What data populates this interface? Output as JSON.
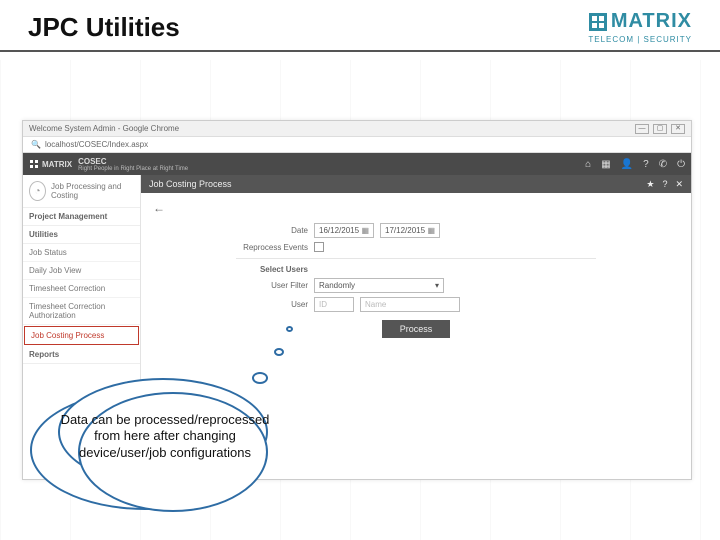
{
  "slide": {
    "title": "JPC Utilities"
  },
  "brand": {
    "name": "MATRIX",
    "sub": "TELECOM | SECURITY"
  },
  "browser": {
    "tab_title": "Welcome System Admin - Google Chrome",
    "url_prefix": "🔍",
    "url": "localhost/COSEC/Index.aspx"
  },
  "appbar": {
    "logo": "MATRIX",
    "product": "COSEC",
    "tagline": "Right People in Right Place at Right Time",
    "icons": {
      "home": "⌂",
      "apps": "▦",
      "user": "👤",
      "help": "?",
      "phone": "✆",
      "power": "⏻"
    }
  },
  "sidebar": {
    "module": "Job Processing and Costing",
    "sections": {
      "pm": "Project Management",
      "util": "Utilities",
      "reports": "Reports"
    },
    "items": {
      "job_status": "Job Status",
      "daily_job_view": "Daily Job View",
      "ts_correction": "Timesheet Correction",
      "ts_auth": "Timesheet Correction Authorization",
      "job_costing": "Job Costing Process"
    }
  },
  "panel": {
    "title": "Job Costing Process",
    "icons": {
      "star": "★",
      "help": "?",
      "close": "✕"
    },
    "back": "←",
    "labels": {
      "date": "Date",
      "reprocess": "Reprocess Events",
      "select_users": "Select Users",
      "user_filter": "User Filter",
      "user": "User"
    },
    "date_from": "16/12/2015",
    "date_to": "17/12/2015",
    "filter_value": "Randomly",
    "user_id_placeholder": "ID",
    "user_name_placeholder": "Name",
    "process_btn": "Process"
  },
  "callout": {
    "text": "Data can be processed/reprocessed from here after changing device/user/job configurations"
  }
}
